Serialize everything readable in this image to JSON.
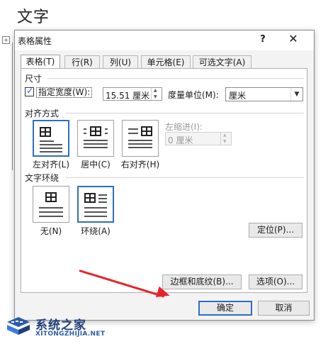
{
  "document": {
    "heading": "文字",
    "move_handle": "+"
  },
  "dialog": {
    "title": "表格属性",
    "help": "?",
    "close": "✕",
    "tabs": [
      {
        "label": "表格(T)",
        "active": true
      },
      {
        "label": "行(R)",
        "active": false
      },
      {
        "label": "列(U)",
        "active": false
      },
      {
        "label": "单元格(E)",
        "active": false
      },
      {
        "label": "可选文字(A)",
        "active": false
      }
    ],
    "size": {
      "section": "尺寸",
      "preferred_width_label": "指定宽度(W):",
      "preferred_width_checked": true,
      "width_value": "15.51 厘米",
      "measure_in_label": "度量单位(M):",
      "measure_in_value": "厘米"
    },
    "alignment": {
      "section": "对齐方式",
      "options": [
        {
          "label": "左对齐(L)",
          "selected": true
        },
        {
          "label": "居中(C)",
          "selected": false
        },
        {
          "label": "右对齐(H)",
          "selected": false
        }
      ],
      "indent_label": "左缩进(I):",
      "indent_value": "0 厘米"
    },
    "wrapping": {
      "section": "文字环绕",
      "options": [
        {
          "label": "无(N)",
          "selected": false
        },
        {
          "label": "环绕(A)",
          "selected": true
        }
      ],
      "positioning_button": "定位(P)..."
    },
    "borders_button": "边框和底纹(B)...",
    "options_button": "选项(O)...",
    "ok_button": "确定",
    "cancel_button": "取消"
  },
  "watermark": {
    "name": "系统之家",
    "url": "XITONGZHIJIA.NET"
  },
  "colors": {
    "accent": "#2f6fbf",
    "arrow": "#e8232b",
    "watermark": "#1f3f7a"
  }
}
